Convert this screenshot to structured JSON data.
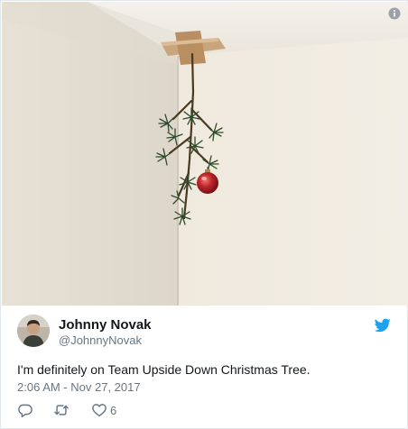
{
  "media": {
    "alt_icon": "info-icon"
  },
  "author": {
    "name": "Johnny Novak",
    "handle": "@JohnnyNovak",
    "avatar_icon": "avatar",
    "platform_icon": "twitter-bird-icon"
  },
  "tweet": {
    "text": "I'm definitely on Team Upside Down Christmas Tree.",
    "timestamp": "2:06 AM - Nov 27, 2017"
  },
  "actions": {
    "reply_icon": "reply-icon",
    "retweet_icon": "retweet-icon",
    "like_icon": "heart-icon",
    "like_count": "6"
  },
  "colors": {
    "brand_blue": "#1da1f2",
    "secondary_text": "#657786",
    "ornament_red": "#c0262b"
  }
}
